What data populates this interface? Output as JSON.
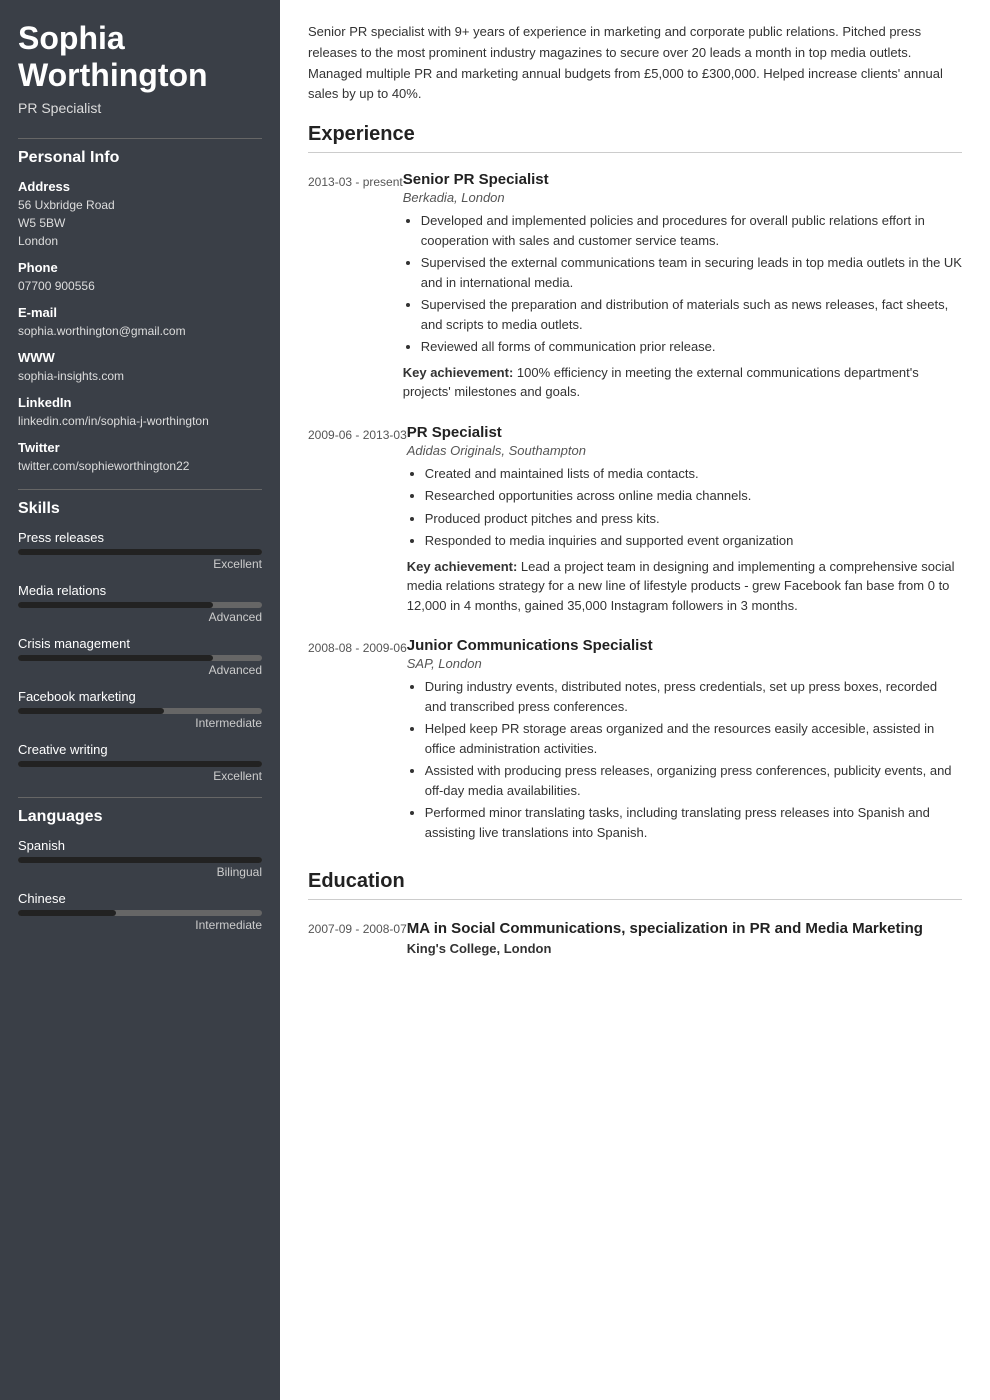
{
  "sidebar": {
    "name": "Sophia Worthington",
    "subtitle": "PR Specialist",
    "personal_info": {
      "section_title": "Personal Info",
      "address_label": "Address",
      "address_line1": "56 Uxbridge Road",
      "address_line2": "W5 5BW",
      "address_line3": "London",
      "phone_label": "Phone",
      "phone": "07700 900556",
      "email_label": "E-mail",
      "email": "sophia.worthington@gmail.com",
      "www_label": "WWW",
      "www": "sophia-insights.com",
      "linkedin_label": "LinkedIn",
      "linkedin": "linkedin.com/in/sophia-j-worthington",
      "twitter_label": "Twitter",
      "twitter": "twitter.com/sophieworthington22"
    },
    "skills": {
      "section_title": "Skills",
      "items": [
        {
          "name": "Press releases",
          "percent": 100,
          "level": "Excellent"
        },
        {
          "name": "Media relations",
          "percent": 80,
          "level": "Advanced"
        },
        {
          "name": "Crisis management",
          "percent": 80,
          "level": "Advanced"
        },
        {
          "name": "Facebook marketing",
          "percent": 60,
          "level": "Intermediate"
        },
        {
          "name": "Creative writing",
          "percent": 100,
          "level": "Excellent"
        }
      ]
    },
    "languages": {
      "section_title": "Languages",
      "items": [
        {
          "name": "Spanish",
          "percent": 100,
          "level": "Bilingual"
        },
        {
          "name": "Chinese",
          "percent": 40,
          "level": "Intermediate"
        }
      ]
    }
  },
  "main": {
    "summary": "Senior PR specialist with 9+ years of experience in marketing and corporate public relations. Pitched press releases to the most prominent industry magazines to secure over 20 leads a month in top media outlets. Managed multiple PR and marketing annual budgets from £5,000 to £300,000. Helped increase clients' annual sales by up to 40%.",
    "experience": {
      "section_title": "Experience",
      "items": [
        {
          "date": "2013-03 - present",
          "title": "Senior PR Specialist",
          "company": "Berkadia, London",
          "bullets": [
            "Developed and implemented policies and procedures for overall public relations effort in cooperation with sales and customer service teams.",
            "Supervised the external communications team in securing leads in top media outlets in the UK and in international media.",
            "Supervised the preparation and distribution of materials such as news releases, fact sheets, and scripts to media outlets.",
            "Reviewed all forms of communication prior release."
          ],
          "key_achievement": "Key achievement: 100% efficiency in meeting the external communications department's projects' milestones and goals."
        },
        {
          "date": "2009-06 - 2013-03",
          "title": "PR Specialist",
          "company": "Adidas Originals, Southampton",
          "bullets": [
            "Created and maintained lists of media contacts.",
            "Researched opportunities across online media channels.",
            "Produced product pitches and press kits.",
            "Responded to media inquiries and supported event organization"
          ],
          "key_achievement": "Key achievement: Lead a project team in designing and implementing a comprehensive social media relations strategy for a new line of lifestyle products - grew Facebook fan base from 0 to 12,000 in 4 months, gained 35,000 Instagram followers in 3 months."
        },
        {
          "date": "2008-08 - 2009-06",
          "title": "Junior Communications Specialist",
          "company": "SAP, London",
          "bullets": [
            "During industry events, distributed notes, press credentials, set up press boxes, recorded and transcribed press conferences.",
            "Helped keep PR storage areas organized and the resources easily accesible, assisted in office administration activities.",
            "Assisted with producing press releases, organizing press conferences, publicity events, and off-day media availabilities.",
            "Performed minor translating tasks, including translating press releases into Spanish and assisting live translations into Spanish."
          ],
          "key_achievement": ""
        }
      ]
    },
    "education": {
      "section_title": "Education",
      "items": [
        {
          "date": "2007-09 - 2008-07",
          "title": "MA in Social Communications, specialization in PR and Media Marketing",
          "school": "King's College, London"
        }
      ]
    }
  }
}
